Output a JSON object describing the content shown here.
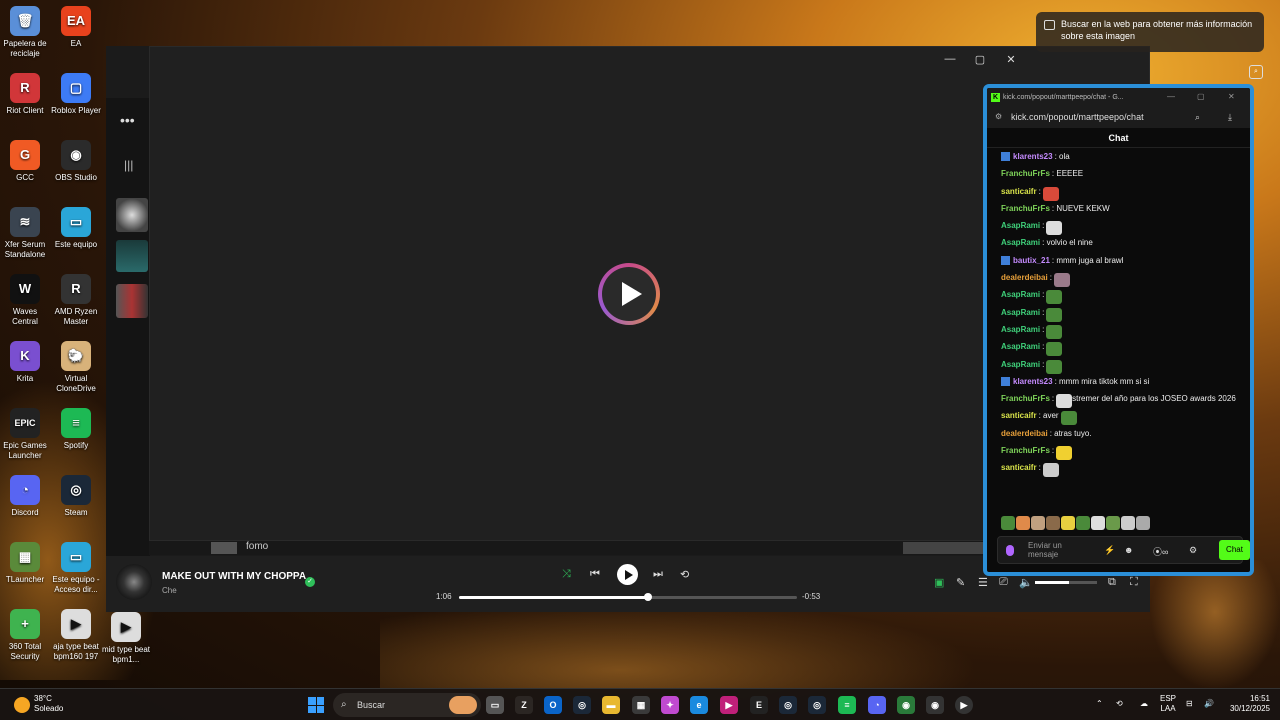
{
  "desktop": {
    "icons": [
      {
        "label": "Papelera de reciclaje",
        "icon": "recycle-bin-icon",
        "color": "#5a8fd8",
        "glyph": "🗑"
      },
      {
        "label": "EA",
        "icon": "ea-icon",
        "color": "#e8421d",
        "glyph": "EA"
      },
      {
        "label": "Riot Client",
        "icon": "riot-icon",
        "color": "#d13639",
        "glyph": "R"
      },
      {
        "label": "Roblox Player",
        "icon": "roblox-icon",
        "color": "#3d7bf5",
        "glyph": "▢"
      },
      {
        "label": "GCC",
        "icon": "gcc-icon",
        "color": "#f05a24",
        "glyph": "G"
      },
      {
        "label": "OBS Studio",
        "icon": "obs-icon",
        "color": "#2b2b2b",
        "glyph": "◉"
      },
      {
        "label": "Xfer Serum Standalone",
        "icon": "serum-icon",
        "color": "#3a4450",
        "glyph": "≋"
      },
      {
        "label": "Este equipo",
        "icon": "computer-icon",
        "color": "#2aa6d8",
        "glyph": "▭"
      },
      {
        "label": "Waves Central",
        "icon": "waves-icon",
        "color": "#111111",
        "glyph": "W"
      },
      {
        "label": "AMD Ryzen Master",
        "icon": "ryzen-icon",
        "color": "#333333",
        "glyph": "R"
      },
      {
        "label": "Krita",
        "icon": "krita-icon",
        "color": "#7a4fd0",
        "glyph": "K"
      },
      {
        "label": "Virtual CloneDrive",
        "icon": "clonedrive-icon",
        "color": "#d8b27a",
        "glyph": "🐑"
      },
      {
        "label": "Epic Games Launcher",
        "icon": "epic-icon",
        "color": "#222222",
        "glyph": "EPIC"
      },
      {
        "label": "Spotify",
        "icon": "spotify-icon",
        "color": "#1db954",
        "glyph": "≡"
      },
      {
        "label": "Discord",
        "icon": "discord-icon",
        "color": "#5865f2",
        "glyph": "◔"
      },
      {
        "label": "Steam",
        "icon": "steam-icon",
        "color": "#1b2838",
        "glyph": "◎"
      },
      {
        "label": "TLauncher",
        "icon": "tlauncher-icon",
        "color": "#5a8a3a",
        "glyph": "▦"
      },
      {
        "label": "Este equipo - Acceso dir...",
        "icon": "computer-shortcut-icon",
        "color": "#2aa6d8",
        "glyph": "▭"
      },
      {
        "label": "360 Total Security",
        "icon": "security-icon",
        "color": "#3fb34f",
        "glyph": "+"
      },
      {
        "label": "aja type beat bpm160 197",
        "icon": "media-file-icon",
        "color": "#dddddd",
        "glyph": "▶"
      },
      {
        "label": "mid type beat bpm1...",
        "icon": "media-file-icon",
        "color": "#dddddd",
        "glyph": "▶"
      }
    ]
  },
  "media_player": {
    "playlist_item": "fomo",
    "song_title": "MAKE OUT WITH MY CHOPPA",
    "artist": "Che",
    "elapsed": "1:06",
    "remaining": "-0:53",
    "progress": 0.56,
    "volume": 0.55
  },
  "search_tip": {
    "text": "Buscar en la web para obtener más información sobre esta imagen"
  },
  "chat": {
    "tab_title": "kick.com/popout/marttpeepo/chat - G...",
    "url": "kick.com/popout/marttpeepo/chat",
    "header": "Chat",
    "input_placeholder": "Enviar un mensaje",
    "send_label": "Chat",
    "messages": [
      {
        "user": "klarents23",
        "color": "#c58bff",
        "badge": true,
        "text": ": ola",
        "emotes": []
      },
      {
        "user": "FranchuFrFs",
        "color": "#7fd45a",
        "badge": false,
        "text": ": EEEEE",
        "emotes": []
      },
      {
        "user": "santicaifr",
        "color": "#d9e34a",
        "badge": false,
        "text": ":",
        "emotes": [
          "#d84a3a"
        ]
      },
      {
        "user": "FranchuFrFs",
        "color": "#7fd45a",
        "badge": false,
        "text": ": NUEVE KEKW",
        "emotes": []
      },
      {
        "user": "AsapRami",
        "color": "#3fd07a",
        "badge": false,
        "text": ":",
        "emotes": [
          "#dddddd"
        ]
      },
      {
        "user": "AsapRami",
        "color": "#3fd07a",
        "badge": false,
        "text": ": volvio el nine",
        "emotes": []
      },
      {
        "user": "bautix_21",
        "color": "#c58bff",
        "badge": true,
        "text": ": mmm juga al brawl",
        "emotes": []
      },
      {
        "user": "dealerdeibai",
        "color": "#e8a03a",
        "badge": false,
        "text": ":",
        "emotes": [
          "#9a7a8a"
        ]
      },
      {
        "user": "AsapRami",
        "color": "#3fd07a",
        "badge": false,
        "text": ":",
        "emotes": [
          "#4a8a3a"
        ]
      },
      {
        "user": "AsapRami",
        "color": "#3fd07a",
        "badge": false,
        "text": ":",
        "emotes": [
          "#4a8a3a"
        ]
      },
      {
        "user": "AsapRami",
        "color": "#3fd07a",
        "badge": false,
        "text": ":",
        "emotes": [
          "#4a8a3a"
        ]
      },
      {
        "user": "AsapRami",
        "color": "#3fd07a",
        "badge": false,
        "text": ":",
        "emotes": [
          "#4a8a3a"
        ]
      },
      {
        "user": "AsapRami",
        "color": "#3fd07a",
        "badge": false,
        "text": ":",
        "emotes": [
          "#4a8a3a"
        ]
      },
      {
        "user": "klarents23",
        "color": "#c58bff",
        "badge": true,
        "text": ": mmm mira tiktok mm si si",
        "emotes": []
      },
      {
        "user": "FranchuFrFs",
        "color": "#7fd45a",
        "badge": false,
        "text": ": stremer del año para los JOSEO awards 2026",
        "emotes": [
          "#dddddd"
        ],
        "emote_first": true
      },
      {
        "user": "santicaifr",
        "color": "#d9e34a",
        "badge": false,
        "text": ": aver",
        "emotes": [
          "#4a8a3a"
        ]
      },
      {
        "user": "dealerdeibai",
        "color": "#e8a03a",
        "badge": false,
        "text": ": atras tuyo.",
        "emotes": []
      },
      {
        "user": "FranchuFrFs",
        "color": "#7fd45a",
        "badge": false,
        "text": ":",
        "emotes": [
          "#f0d030"
        ]
      },
      {
        "user": "santicaifr",
        "color": "#d9e34a",
        "badge": false,
        "text": ":",
        "emotes": [
          "#cccccc"
        ]
      }
    ],
    "emote_bar": [
      "#4a8a3a",
      "#e08a4a",
      "#c0a080",
      "#8a6a4a",
      "#e8d040",
      "#4a8a3a",
      "#dddddd",
      "#6a9a4a",
      "#cccccc",
      "#aaaaaa"
    ]
  },
  "taskbar": {
    "temperature": "38°C",
    "condition": "Soleado",
    "search_label": "Buscar",
    "language": "ESP",
    "layout": "LAA",
    "time": "16:51",
    "date": "30/12/2025"
  }
}
